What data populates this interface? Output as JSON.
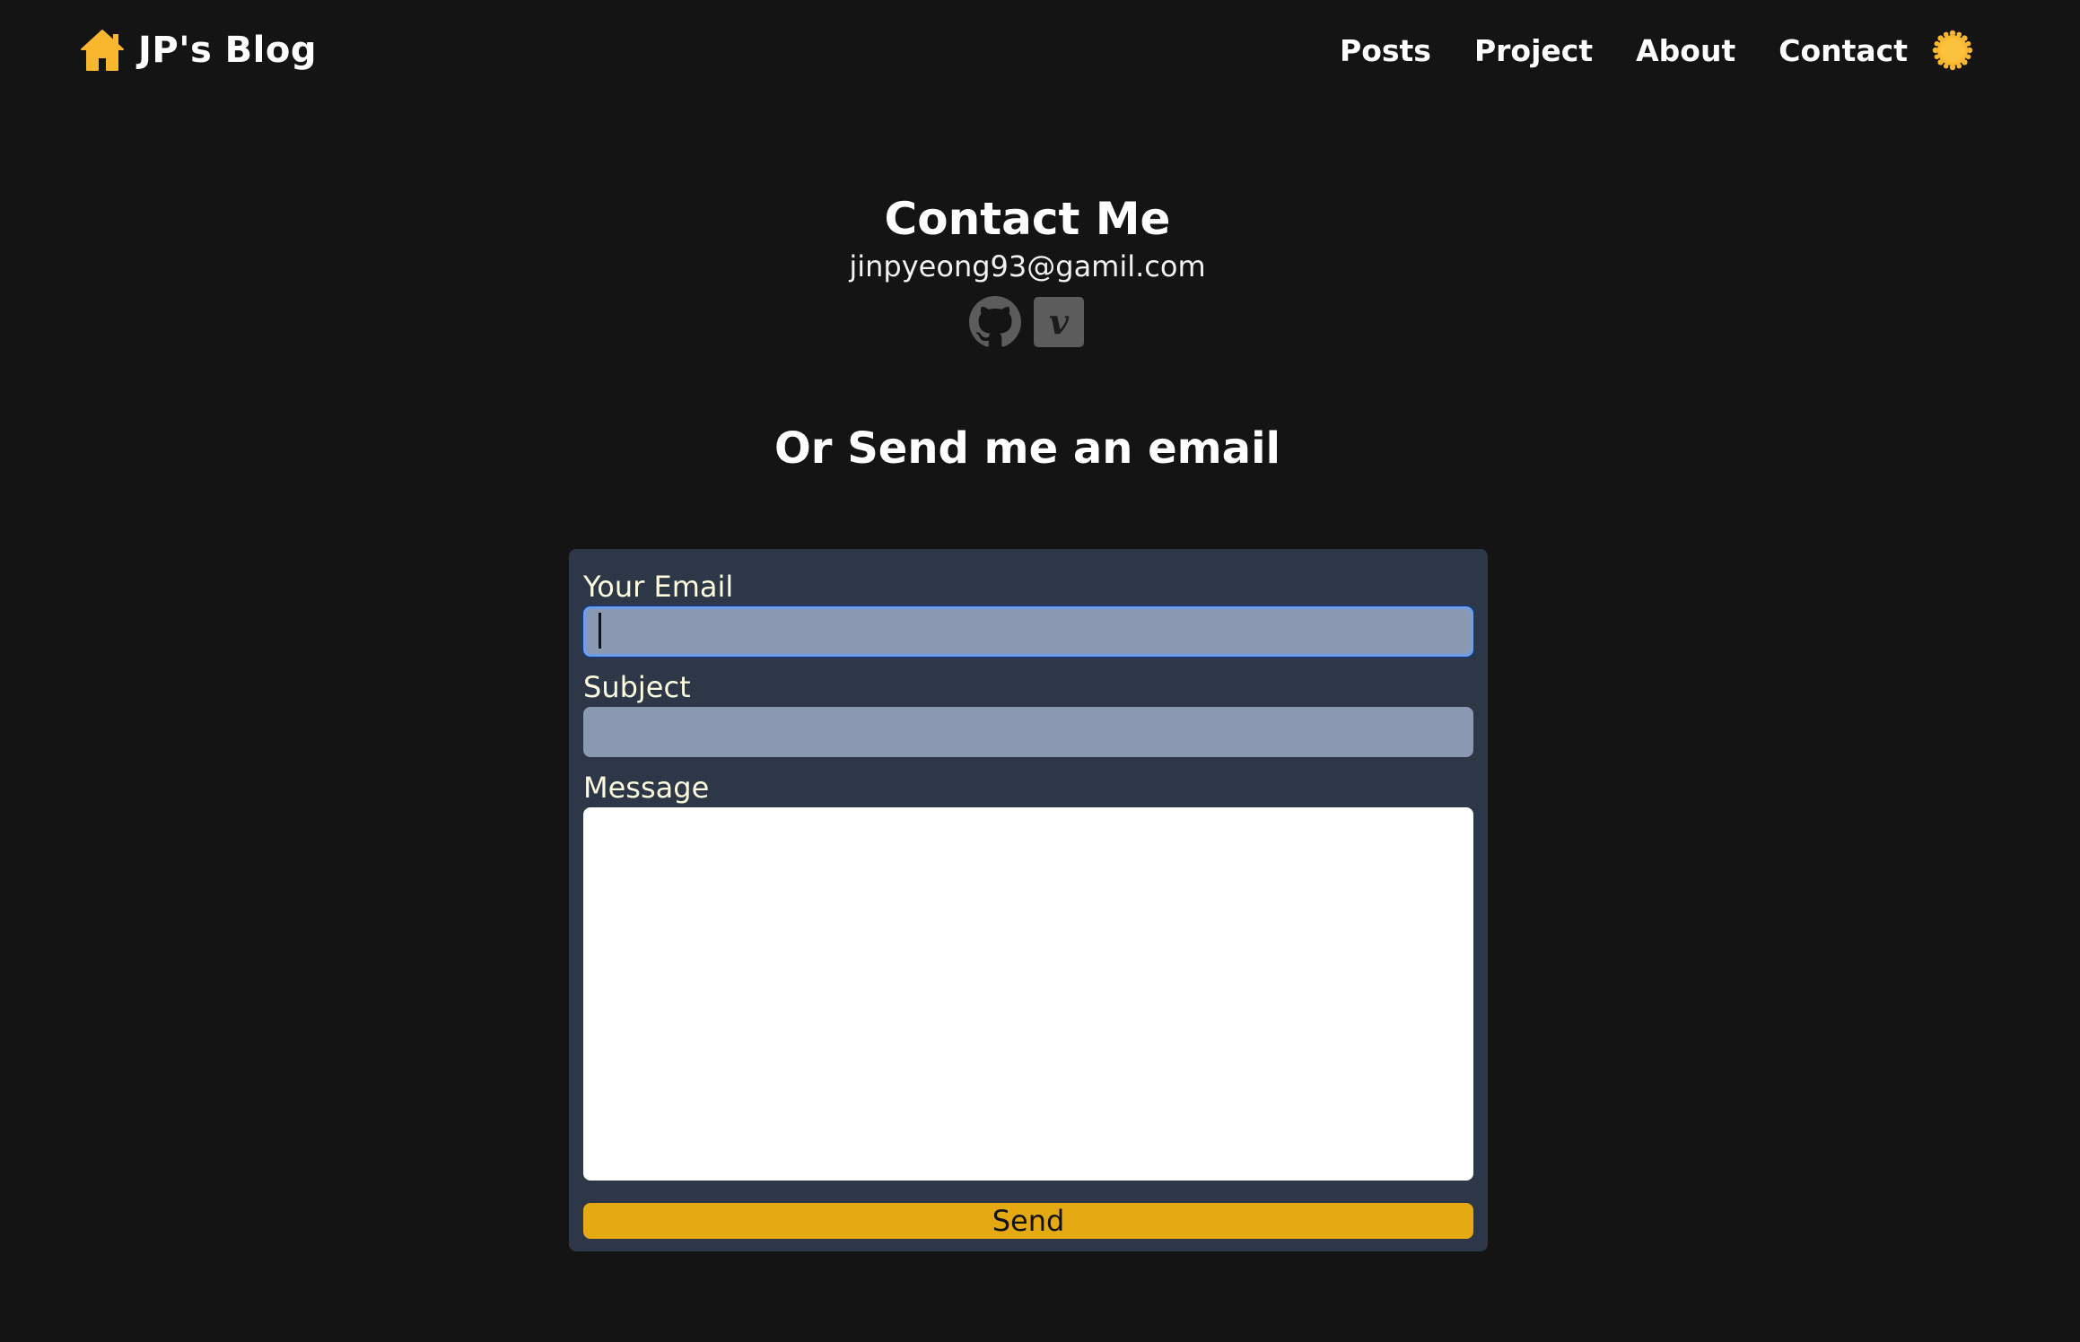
{
  "header": {
    "logo_icon": "home-icon",
    "site_title": "JP's Blog",
    "nav": [
      {
        "label": "Posts"
      },
      {
        "label": "Project"
      },
      {
        "label": "About"
      },
      {
        "label": "Contact"
      }
    ],
    "theme_toggle_icon": "sun-icon"
  },
  "contact": {
    "title": "Contact Me",
    "email": "jinpyeong93@gamil.com",
    "socials": [
      {
        "icon": "github-icon"
      },
      {
        "icon": "velog-icon",
        "glyph": "v"
      }
    ]
  },
  "email_section": {
    "heading": "Or Send me an email"
  },
  "form": {
    "email_label": "Your Email",
    "email_value": "",
    "subject_label": "Subject",
    "subject_value": "",
    "message_label": "Message",
    "message_value": "",
    "send_label": "Send"
  },
  "colors": {
    "background": "#141415",
    "card": "#2d3748",
    "input": "#8a99b1",
    "label": "#fdfde0",
    "accent": "#e5a912",
    "focus_ring": "#6e9ef0",
    "icon_gray": "#5c5c5c"
  }
}
